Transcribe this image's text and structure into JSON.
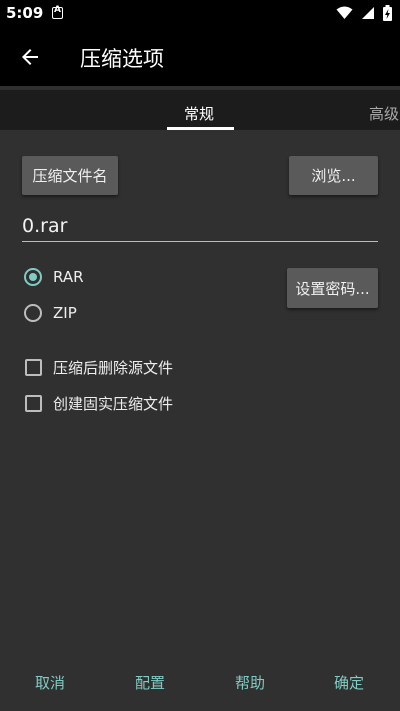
{
  "status_bar": {
    "time": "5:09",
    "icons": [
      "notification-a-icon",
      "wifi-icon",
      "signal-icon",
      "battery-charging-icon"
    ]
  },
  "app_bar": {
    "title": "压缩选项"
  },
  "tabs": [
    {
      "label": "常规",
      "active": true
    },
    {
      "label": "高级",
      "active": false
    }
  ],
  "general": {
    "filename_button": "压缩文件名",
    "browse_button": "浏览...",
    "filename_value": "0.rar",
    "format_options": [
      {
        "label": "RAR",
        "checked": true
      },
      {
        "label": "ZIP",
        "checked": false
      }
    ],
    "password_button": "设置密码...",
    "checkboxes": [
      {
        "label": "压缩后删除源文件",
        "checked": false
      },
      {
        "label": "创建固实压缩文件",
        "checked": false
      }
    ]
  },
  "bottom_actions": {
    "cancel": "取消",
    "config": "配置",
    "help": "帮助",
    "ok": "确定"
  },
  "colors": {
    "accent": "#80cbc4",
    "background": "#303030",
    "toolbar": "#000000",
    "button": "#5a5a5a"
  }
}
